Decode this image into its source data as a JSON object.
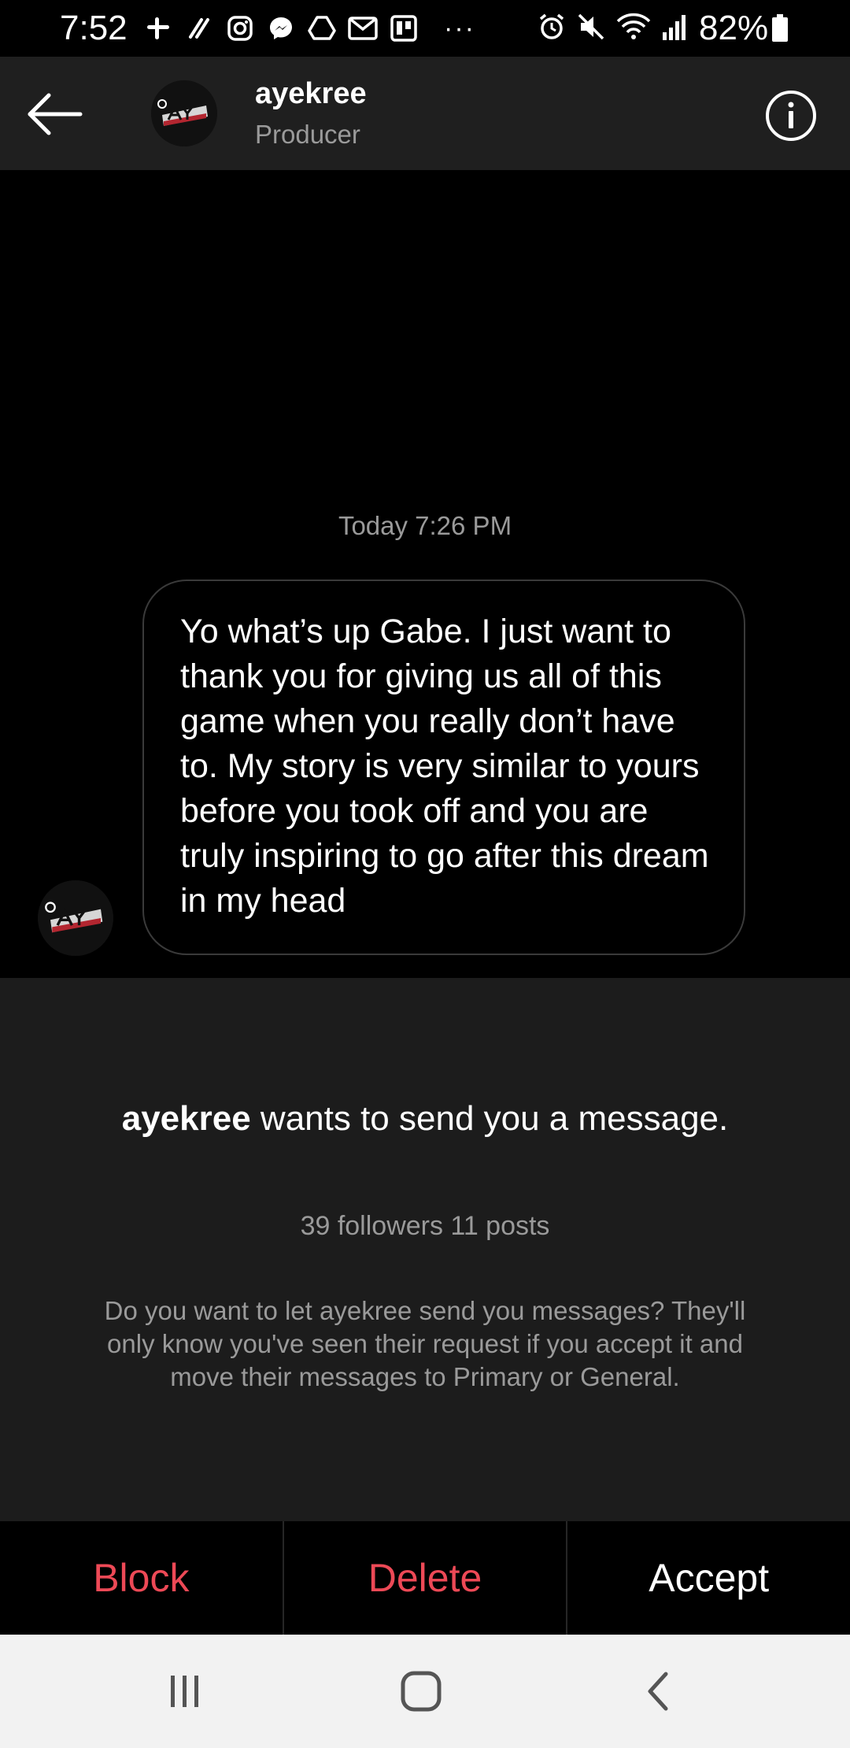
{
  "status_bar": {
    "time": "7:52",
    "overflow_indicator": "···",
    "battery_text": "82%",
    "left_icons": [
      "slack-icon",
      "tag-icon",
      "instagram-icon",
      "messenger-icon",
      "drive-icon",
      "gmail-icon",
      "trello-icon"
    ],
    "right_icons": [
      "alarm-icon",
      "mute-icon",
      "wifi-icon",
      "signal-icon"
    ]
  },
  "header": {
    "username": "ayekree",
    "subtitle": "Producer",
    "back_icon": "back-arrow-icon",
    "info_icon": "info-icon"
  },
  "chat": {
    "timestamp": "Today 7:26 PM",
    "message": "Yo what’s up Gabe. I just want to thank you for giving us all of this game when you really don’t have to. My story is very similar to yours before you took off and you are truly inspiring to go after this dream in my head"
  },
  "request": {
    "username": "ayekree",
    "title_rest": " wants to send you a message.",
    "stats": "39 followers 11 posts",
    "description": "Do you want to let ayekree send you messages? They'll only know you've seen their request if you accept it and move their messages to Primary or General."
  },
  "actions": {
    "block": "Block",
    "delete": "Delete",
    "accept": "Accept"
  },
  "colors": {
    "destructive": "#ed4956",
    "header_bg": "#1f1f1f",
    "panel_bg": "#1c1c1c",
    "muted_text": "#9a9a9a"
  },
  "nav_bar": {
    "icons": [
      "recent-apps-icon",
      "home-icon",
      "back-icon"
    ]
  }
}
